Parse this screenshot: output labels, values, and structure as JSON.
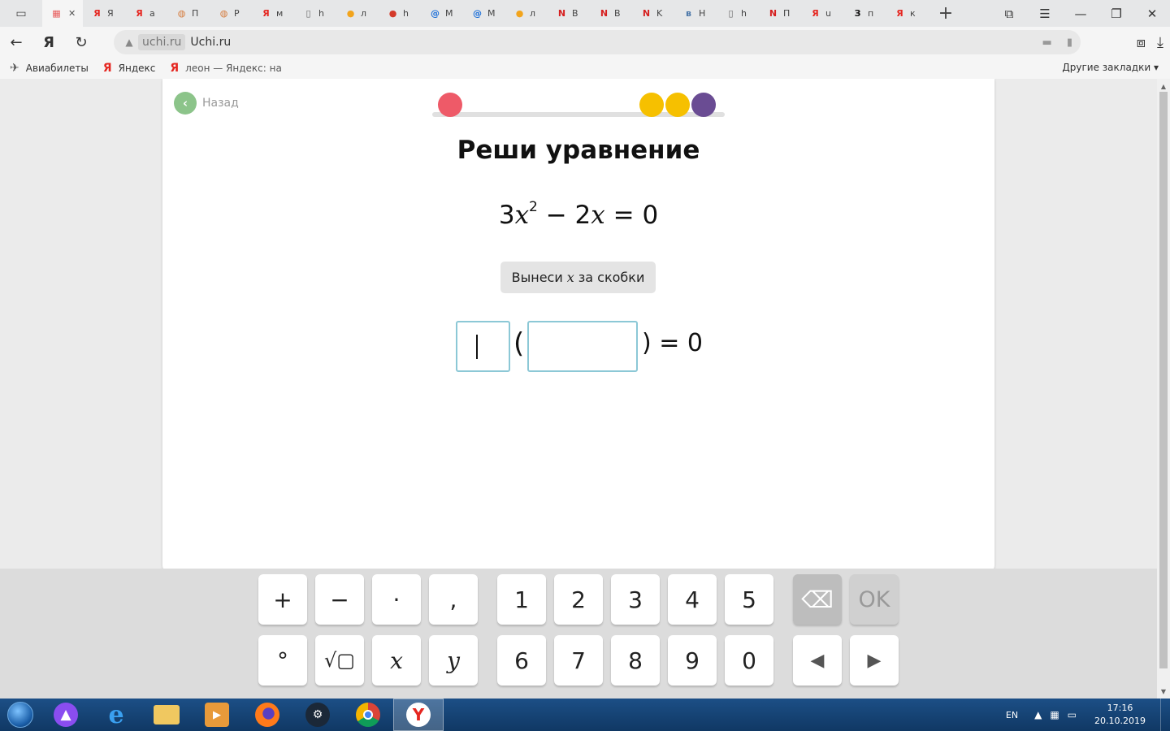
{
  "browser": {
    "tabs": [
      {
        "fav": "▦",
        "color": "#e85a5a",
        "text": "",
        "active": true
      },
      {
        "fav": "Я",
        "color": "#e52620",
        "text": "Я"
      },
      {
        "fav": "Я",
        "color": "#e52620",
        "text": "a"
      },
      {
        "fav": "◍",
        "color": "#d57a3a",
        "text": "П"
      },
      {
        "fav": "◍",
        "color": "#d57a3a",
        "text": "Р"
      },
      {
        "fav": "Я",
        "color": "#e52620",
        "text": "м"
      },
      {
        "fav": "▯",
        "color": "#666666",
        "text": "h"
      },
      {
        "fav": "●",
        "color": "#f2a41c",
        "text": "л"
      },
      {
        "fav": "●",
        "color": "#d43a2a",
        "text": "h"
      },
      {
        "fav": "@",
        "color": "#1a6ed8",
        "text": "M"
      },
      {
        "fav": "@",
        "color": "#1a6ed8",
        "text": "M"
      },
      {
        "fav": "●",
        "color": "#f2a41c",
        "text": "л"
      },
      {
        "fav": "N",
        "color": "#d61f1f",
        "text": "B"
      },
      {
        "fav": "N",
        "color": "#d61f1f",
        "text": "B"
      },
      {
        "fav": "N",
        "color": "#d61f1f",
        "text": "K"
      },
      {
        "fav": "в",
        "color": "#4a76a8",
        "text": "H"
      },
      {
        "fav": "▯",
        "color": "#666666",
        "text": "h"
      },
      {
        "fav": "N",
        "color": "#d61f1f",
        "text": "П"
      },
      {
        "fav": "Я",
        "color": "#e52620",
        "text": "u"
      },
      {
        "fav": "З",
        "color": "#111111",
        "text": "п"
      },
      {
        "fav": "Я",
        "color": "#e52620",
        "text": "к"
      }
    ],
    "tab_add": "+",
    "nav": {
      "back": "←",
      "yandex": "Я",
      "reload": "↻"
    },
    "address": {
      "lock": "🔒",
      "domain": "uchi.ru",
      "title": "Uchi.ru"
    },
    "bookmarks": [
      {
        "icon": "✈",
        "label": "Авиабилеты"
      },
      {
        "icon": "Я",
        "label": "Яндекс"
      },
      {
        "icon": "Я",
        "label": "леон — Яндекс: на"
      }
    ],
    "other_bookmarks": "Другие закладки ▾"
  },
  "page": {
    "back_label": "Назад",
    "progress_dots": [
      {
        "color": "#ee5a68"
      },
      {
        "color": "#f6c000"
      },
      {
        "color": "#f6c000"
      },
      {
        "color": "#6a4c93"
      }
    ],
    "task_title": "Реши уравнение",
    "equation": {
      "coef": "3",
      "var": "x",
      "power": "2",
      "rest_a": " − 2",
      "var2": "x",
      "rest_b": " = 0"
    },
    "hint": {
      "before": "Вынеси",
      "var": "x",
      "after": "за скобки"
    },
    "answer": {
      "open_paren": "(",
      "close_tail": ") = 0"
    }
  },
  "keyboard": {
    "row1": [
      "+",
      "−",
      "·",
      ",",
      "1",
      "2",
      "3",
      "4",
      "5"
    ],
    "row2_symbols": [
      "°",
      "√▢",
      "x",
      "y"
    ],
    "row2_digits": [
      "6",
      "7",
      "8",
      "9",
      "0"
    ],
    "backspace": "⌫",
    "ok": "OK",
    "left": "◀",
    "right": "▶"
  },
  "taskbar": {
    "lang": "EN",
    "time": "17:16",
    "date": "20.10.2019"
  }
}
